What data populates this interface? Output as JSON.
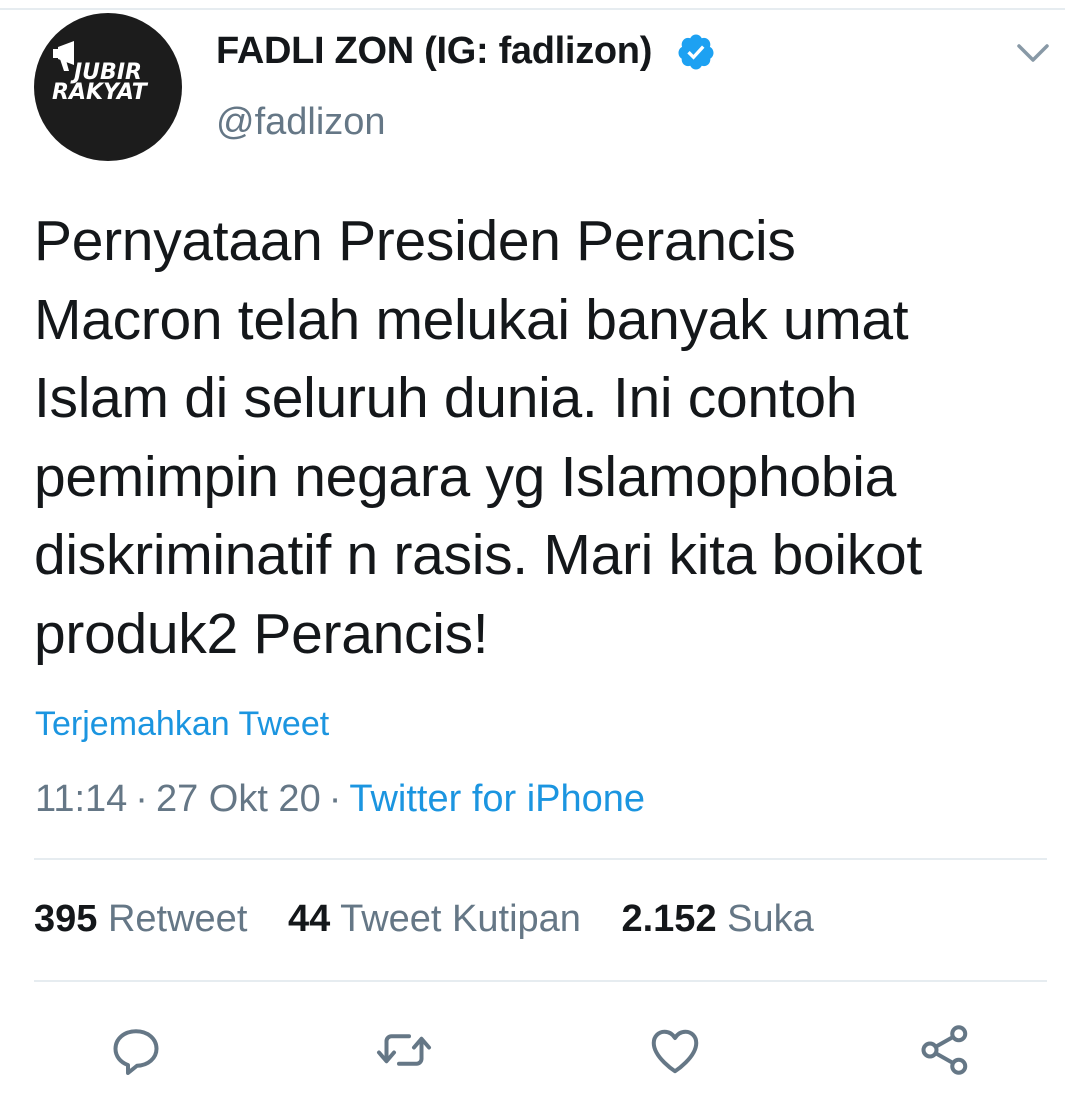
{
  "author": {
    "avatar_text_line1": "JUBIR",
    "avatar_text_line2": "RAKYAT",
    "display_name": "FADLI ZON (IG: fadlizon)",
    "handle": "@fadlizon",
    "verified": true
  },
  "tweet": {
    "text_lines": [
      "Pernyataan Presiden Perancis",
      "Macron telah melukai banyak umat",
      "Islam di seluruh dunia. Ini contoh",
      "pemimpin negara yg Islamophobia",
      "diskriminatif n rasis. Mari kita boikot",
      "produk2 Perancis!"
    ],
    "translate_label": "Terjemahkan Tweet",
    "time": "11:14",
    "separator": "·",
    "date": "27 Okt 20",
    "source": "Twitter for iPhone"
  },
  "stats": {
    "retweets": {
      "count": "395",
      "label": "Retweet"
    },
    "quotes": {
      "count": "44",
      "label": "Tweet Kutipan"
    },
    "likes": {
      "count": "2.152",
      "label": "Suka"
    }
  },
  "icons": {
    "menu": "chevron-down-icon",
    "verified": "verified-badge-icon",
    "reply": "reply-icon",
    "retweet": "retweet-icon",
    "like": "heart-icon",
    "share": "share-icon"
  },
  "colors": {
    "link_blue": "#1b95e0",
    "text_primary": "#14171a",
    "text_secondary": "#657786",
    "divider": "#e6ecf0",
    "avatar_bg": "#1c1c1c"
  }
}
